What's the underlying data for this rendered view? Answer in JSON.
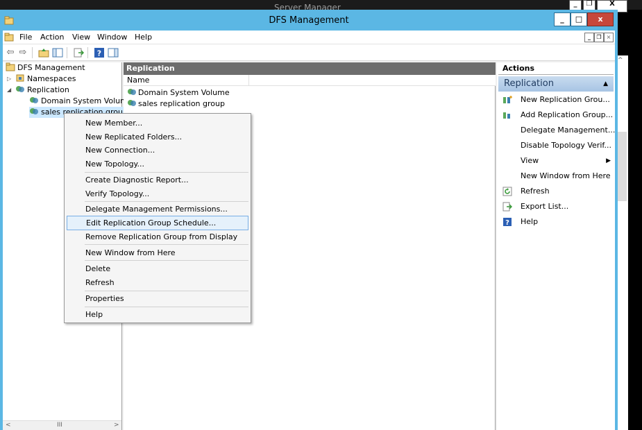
{
  "background_window": {
    "title": "Server Manager",
    "controls": [
      "_",
      "❐",
      "X"
    ]
  },
  "window": {
    "title": "DFS Management",
    "controls": {
      "minimize": "_",
      "maximize": "□",
      "close": "x"
    }
  },
  "menu": {
    "items": [
      "File",
      "Action",
      "View",
      "Window",
      "Help"
    ],
    "mdi_controls": [
      "_",
      "❐",
      "×"
    ]
  },
  "toolbar": {
    "icons": [
      "back-arrow-icon",
      "forward-arrow-icon",
      "up-folder-icon",
      "show-hide-tree-icon",
      "export-list-icon",
      "help-icon",
      "show-hide-action-pane-icon"
    ]
  },
  "tree": {
    "root": "DFS Management",
    "namespaces": "Namespaces",
    "replication": "Replication",
    "children": [
      "Domain System Volume",
      "sales replication group"
    ],
    "scroll": {
      "left": "<",
      "thumb": "III",
      "right": ">"
    }
  },
  "results": {
    "header": "Replication",
    "column": "Name",
    "rows": [
      "Domain System Volume",
      "sales replication group"
    ]
  },
  "actions": {
    "header": "Actions",
    "section": "Replication",
    "items": [
      {
        "label": "New Replication Grou...",
        "icon": "new-replication-group-icon"
      },
      {
        "label": "Add Replication Group...",
        "icon": "add-replication-group-icon"
      },
      {
        "label": "Delegate Management...",
        "icon": ""
      },
      {
        "label": "Disable Topology Verif...",
        "icon": ""
      },
      {
        "label": "View",
        "icon": "",
        "submenu": "▶"
      },
      {
        "label": "New Window from Here",
        "icon": ""
      },
      {
        "label": "Refresh",
        "icon": "refresh-icon"
      },
      {
        "label": "Export List...",
        "icon": "export-list-icon"
      },
      {
        "label": "Help",
        "icon": "help-icon"
      }
    ]
  },
  "context_menu": {
    "groups": [
      [
        "New Member...",
        "New Replicated Folders...",
        "New Connection...",
        "New Topology..."
      ],
      [
        "Create Diagnostic Report...",
        "Verify Topology..."
      ],
      [
        "Delegate Management Permissions...",
        "Edit Replication Group Schedule...",
        "Remove Replication Group from Display"
      ],
      [
        "New Window from Here"
      ],
      [
        "Delete",
        "Refresh"
      ],
      [
        "Properties"
      ],
      [
        "Help"
      ]
    ],
    "highlighted": "Edit Replication Group Schedule..."
  },
  "colors": {
    "titlebar": "#5bb7e4",
    "close": "#c7473b",
    "pane_header": "#6d6d6d",
    "action_section": "#a7c4e4",
    "menu_highlight": "#e5f1fb"
  }
}
